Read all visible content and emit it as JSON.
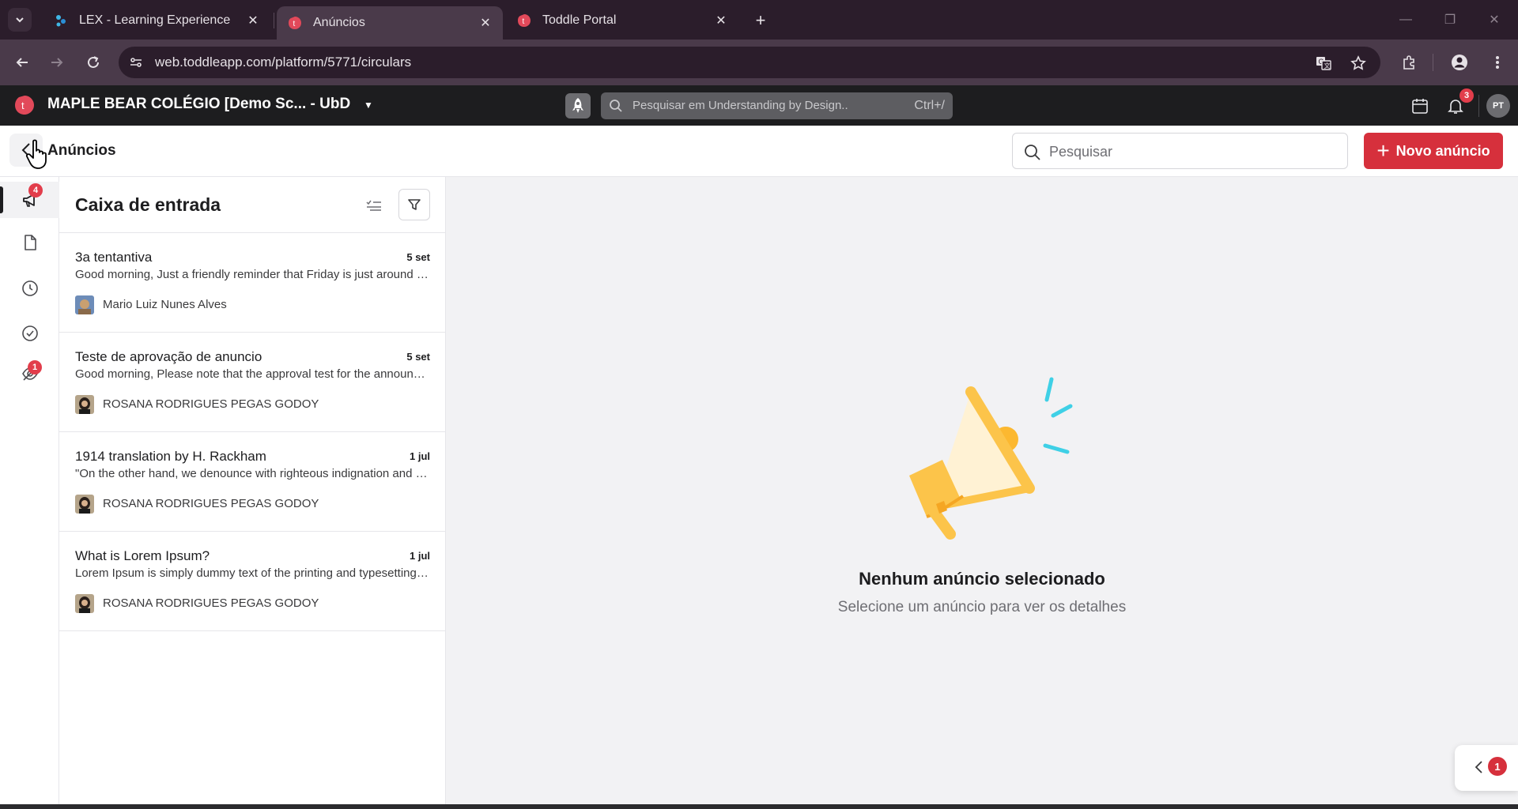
{
  "browser": {
    "tabs": [
      {
        "title": "LEX - Learning Experience",
        "favicon": "lex-icon",
        "active": false
      },
      {
        "title": "Anúncios",
        "favicon": "toddle-icon",
        "active": true
      },
      {
        "title": "Toddle Portal",
        "favicon": "toddle-icon",
        "active": false
      }
    ],
    "url": "web.toddleapp.com/platform/5771/circulars"
  },
  "app_header": {
    "school_name": "MAPLE BEAR COLÉGIO [Demo Sc... - UbD",
    "search_placeholder": "Pesquisar em Understanding by Design..",
    "search_shortcut": "Ctrl+/",
    "notification_count": "3",
    "avatar_initials": "PT"
  },
  "page_header": {
    "title": "Anúncios",
    "search_placeholder": "Pesquisar",
    "new_button_label": "Novo anúncio"
  },
  "rail": {
    "items": [
      {
        "icon": "megaphone-icon",
        "badge": "4",
        "active": true
      },
      {
        "icon": "document-icon",
        "badge": null,
        "active": false
      },
      {
        "icon": "clock-icon",
        "badge": null,
        "active": false
      },
      {
        "icon": "check-circle-icon",
        "badge": null,
        "active": false
      },
      {
        "icon": "eye-off-icon",
        "badge": "1",
        "active": false
      }
    ]
  },
  "inbox": {
    "title": "Caixa de entrada",
    "messages": [
      {
        "subject": "3a tentantiva",
        "date": "5 set",
        "preview": "Good morning, Just a friendly reminder that Friday is just around the corner!",
        "author": "Mario Luiz Nunes Alves"
      },
      {
        "subject": "Teste de aprovação de anuncio",
        "date": "5 set",
        "preview": "Good morning, Please note that the approval test for the announcement is scheduled",
        "author": "ROSANA RODRIGUES PEGAS GODOY"
      },
      {
        "subject": "1914 translation by H. Rackham",
        "date": "1 jul",
        "preview": "\"On the other hand, we denounce with righteous indignation and dislike men who are",
        "author": "ROSANA RODRIGUES PEGAS GODOY"
      },
      {
        "subject": "What is Lorem Ipsum?",
        "date": "1 jul",
        "preview": "Lorem Ipsum is simply dummy text of the printing and typesetting industry.",
        "author": "ROSANA RODRIGUES PEGAS GODOY"
      }
    ]
  },
  "empty_state": {
    "title": "Nenhum anúncio selecionado",
    "subtitle": "Selecione um anúncio para ver os detalhes"
  },
  "chat_fab": {
    "badge": "1"
  },
  "colors": {
    "brand_red": "#d6303c",
    "badge_red": "#e23d4b",
    "megaphone_yellow": "#fcc44a",
    "accent_cyan": "#3fd0e6"
  }
}
